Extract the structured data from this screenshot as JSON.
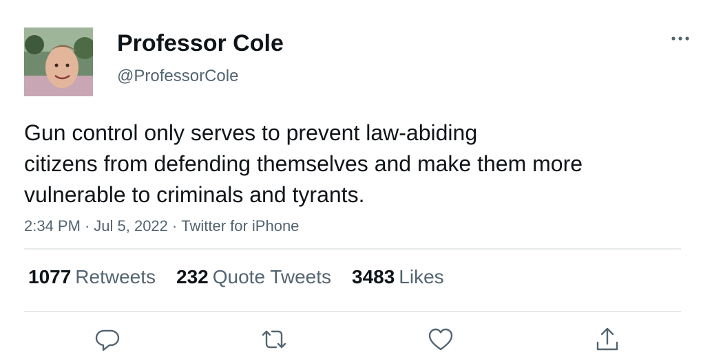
{
  "author": {
    "display_name": "Professor Cole",
    "handle": "@ProfessorCole",
    "avatar_icon": "profile-photo"
  },
  "tweet": {
    "text_lines": [
      "Gun control only serves to prevent law-abiding",
      "citizens from defending themselves and make them more",
      "vulnerable to criminals and tyrants."
    ],
    "time": "2:34 PM",
    "date": "Jul 5, 2022",
    "source": "Twitter for iPhone",
    "separator": "·"
  },
  "stats": {
    "retweets": {
      "count": "1077",
      "label": "Retweets"
    },
    "quote_tweets": {
      "count": "232",
      "label": "Quote Tweets"
    },
    "likes": {
      "count": "3483",
      "label": "Likes"
    }
  },
  "actions": {
    "reply_icon": "reply-icon",
    "retweet_icon": "retweet-icon",
    "like_icon": "heart-icon",
    "share_icon": "share-icon"
  },
  "colors": {
    "text_primary": "#0f1419",
    "text_secondary": "#536471",
    "divider": "#e6e9eb",
    "icon": "#536471"
  }
}
